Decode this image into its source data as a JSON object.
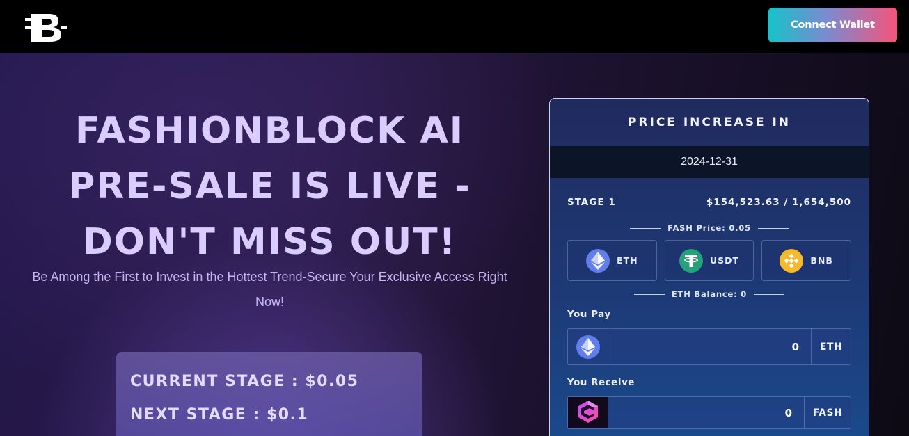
{
  "header": {
    "logo_text": "B",
    "connect_label": "Connect Wallet"
  },
  "hero": {
    "title": "FASHIONBLOCK AI PRE-SALE IS LIVE - DON'T MISS OUT!",
    "subtitle": "Be Among the First to Invest in the Hottest Trend-Secure Your Exclusive Access Right Now!",
    "current_stage": "CURRENT STAGE : $0.05",
    "next_stage": "NEXT STAGE : $0.1"
  },
  "widget": {
    "title": "PRICE INCREASE IN",
    "date": "2024-12-31",
    "stage_label": "STAGE 1",
    "raised": "$154,523.63 / 1,654,500",
    "price_label": "FASH Price: 0.05",
    "tokens": [
      {
        "name": "ETH",
        "icon": "eth-icon",
        "color": "#627eea"
      },
      {
        "name": "USDT",
        "icon": "usdt-icon",
        "color": "#26a17b"
      },
      {
        "name": "BNB",
        "icon": "bnb-icon",
        "color": "#f3ba2f"
      }
    ],
    "balance_label": "ETH Balance: 0",
    "pay": {
      "label": "You Pay",
      "value": "0",
      "unit": "ETH"
    },
    "receive": {
      "label": "You Receive",
      "value": "0",
      "unit": "FASH"
    }
  },
  "colors": {
    "accent_title": "#d9ccff",
    "button_gradient": [
      "#16c3c9",
      "#f5547a"
    ]
  }
}
